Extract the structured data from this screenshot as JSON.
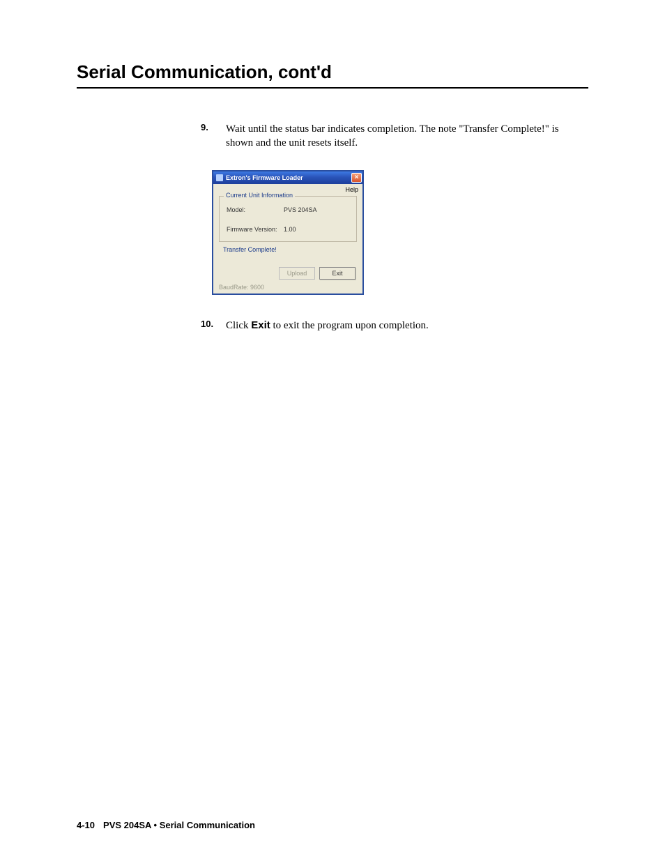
{
  "heading": "Serial Communication, cont'd",
  "steps": {
    "s9": {
      "num": "9.",
      "text": "Wait until the status bar indicates completion.  The note \"Transfer Complete!\" is shown and the unit resets itself."
    },
    "s10": {
      "num": "10.",
      "text_pre": "Click ",
      "text_bold": "Exit",
      "text_post": " to exit the program upon completion."
    }
  },
  "dialog": {
    "title": "Extron's Firmware Loader",
    "menu_help": "Help",
    "group_legend": "Current Unit Information",
    "model_label": "Model:",
    "model_value": "PVS 204SA",
    "fw_label": "Firmware Version:",
    "fw_value": "1.00",
    "status": "Transfer Complete!",
    "btn_upload": "Upload",
    "btn_exit": "Exit",
    "baud": "BaudRate: 9600",
    "close_glyph": "×"
  },
  "footer": {
    "page": "4-10",
    "title": "PVS 204SA • Serial Communication"
  }
}
